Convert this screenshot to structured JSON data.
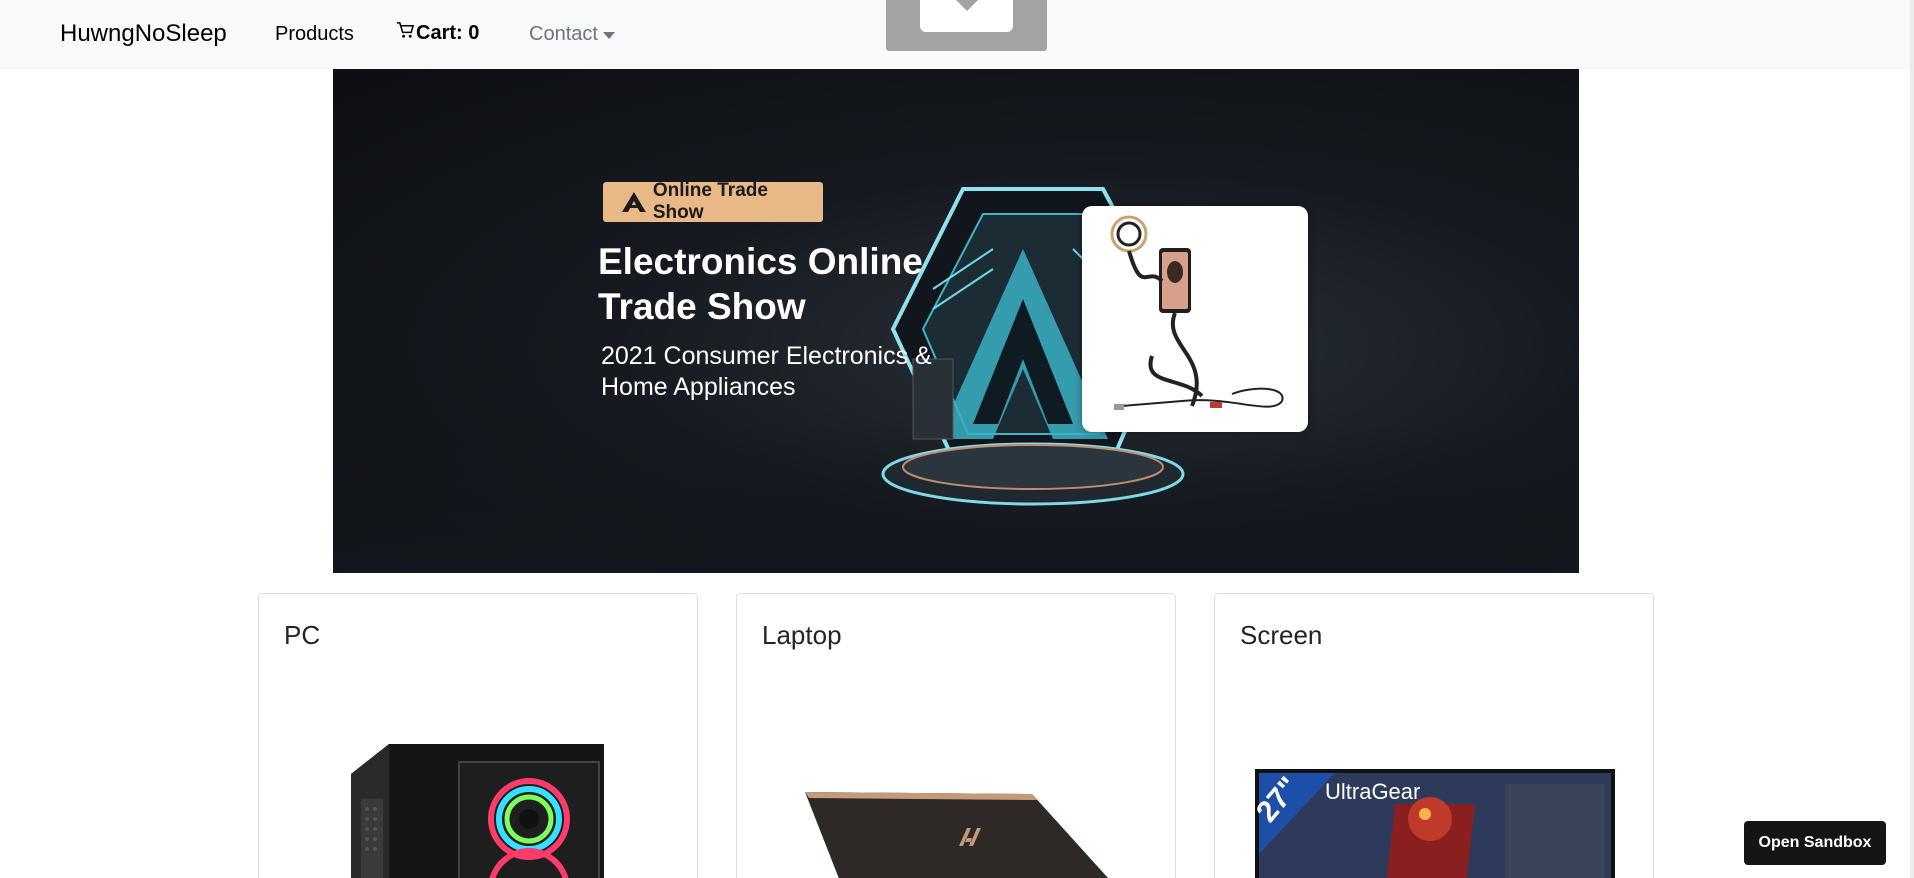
{
  "navbar": {
    "brand": "HuwngNoSleep",
    "products_label": "Products",
    "cart_label": "Cart: 0",
    "contact_label": "Contact"
  },
  "banner": {
    "badge": "Online Trade Show",
    "title": "Electronics Online Trade Show",
    "subtitle": "2021 Consumer Electronics & Home Appliances"
  },
  "products": [
    {
      "title": "PC"
    },
    {
      "title": "Laptop"
    },
    {
      "title": "Screen",
      "image_text": "UltraGear"
    }
  ],
  "sandbox_button": "Open Sandbox",
  "colors": {
    "navbar_bg": "#f8f9fa",
    "muted_text": "#6c757d",
    "badge_bg": "#e8b887",
    "banner_bg": "#161a20",
    "accent_cyan": "#5fd6e6"
  },
  "icons": [
    "cart-icon",
    "caret-down-icon",
    "image-placeholder-icon"
  ]
}
